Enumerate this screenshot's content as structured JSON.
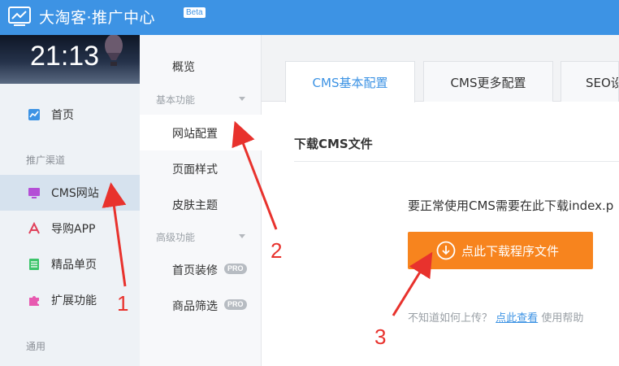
{
  "header": {
    "brand": "大淘客·推广中心",
    "badge": "Beta",
    "logo_icon": "monitor-chart-icon"
  },
  "sidebar": {
    "clock": "21:13",
    "home": {
      "label": "首页",
      "icon": "chart-icon"
    },
    "section_promo": "推广渠道",
    "items": [
      {
        "label": "CMS网站",
        "icon": "monitor-icon",
        "active": true
      },
      {
        "label": "导购APP",
        "icon": "app-icon",
        "active": false
      },
      {
        "label": "精品单页",
        "icon": "page-icon",
        "active": false
      },
      {
        "label": "扩展功能",
        "icon": "puzzle-icon",
        "active": false
      }
    ],
    "section_general": "通用"
  },
  "subnav": {
    "overview": "概览",
    "group_basic": "基本功能",
    "basic_items": [
      "网站配置",
      "页面样式",
      "皮肤主题"
    ],
    "group_advanced": "高级功能",
    "advanced_items": [
      {
        "label": "首页装修",
        "badge": "PRO"
      },
      {
        "label": "商品筛选",
        "badge": "PRO"
      }
    ]
  },
  "main": {
    "tabs": [
      {
        "label": "CMS基本配置",
        "active": true
      },
      {
        "label": "CMS更多配置",
        "active": false
      },
      {
        "label": "SEO设",
        "active": false
      }
    ],
    "section_title": "下载CMS文件",
    "description": "要正常使用CMS需要在此下载index.p",
    "download_button": "点此下载程序文件",
    "help_prefix": "不知道如何上传？",
    "help_link": "点此查看",
    "help_suffix": "使用帮助"
  },
  "annotations": [
    "1",
    "2",
    "3"
  ],
  "colors": {
    "brand_blue": "#3d93e4",
    "button_orange": "#f7841e",
    "annotation_red": "#e8322d",
    "icon_purple": "#b44fd6",
    "icon_red": "#e0405a",
    "icon_green": "#3cc46a",
    "icon_pink": "#e75ab0"
  }
}
